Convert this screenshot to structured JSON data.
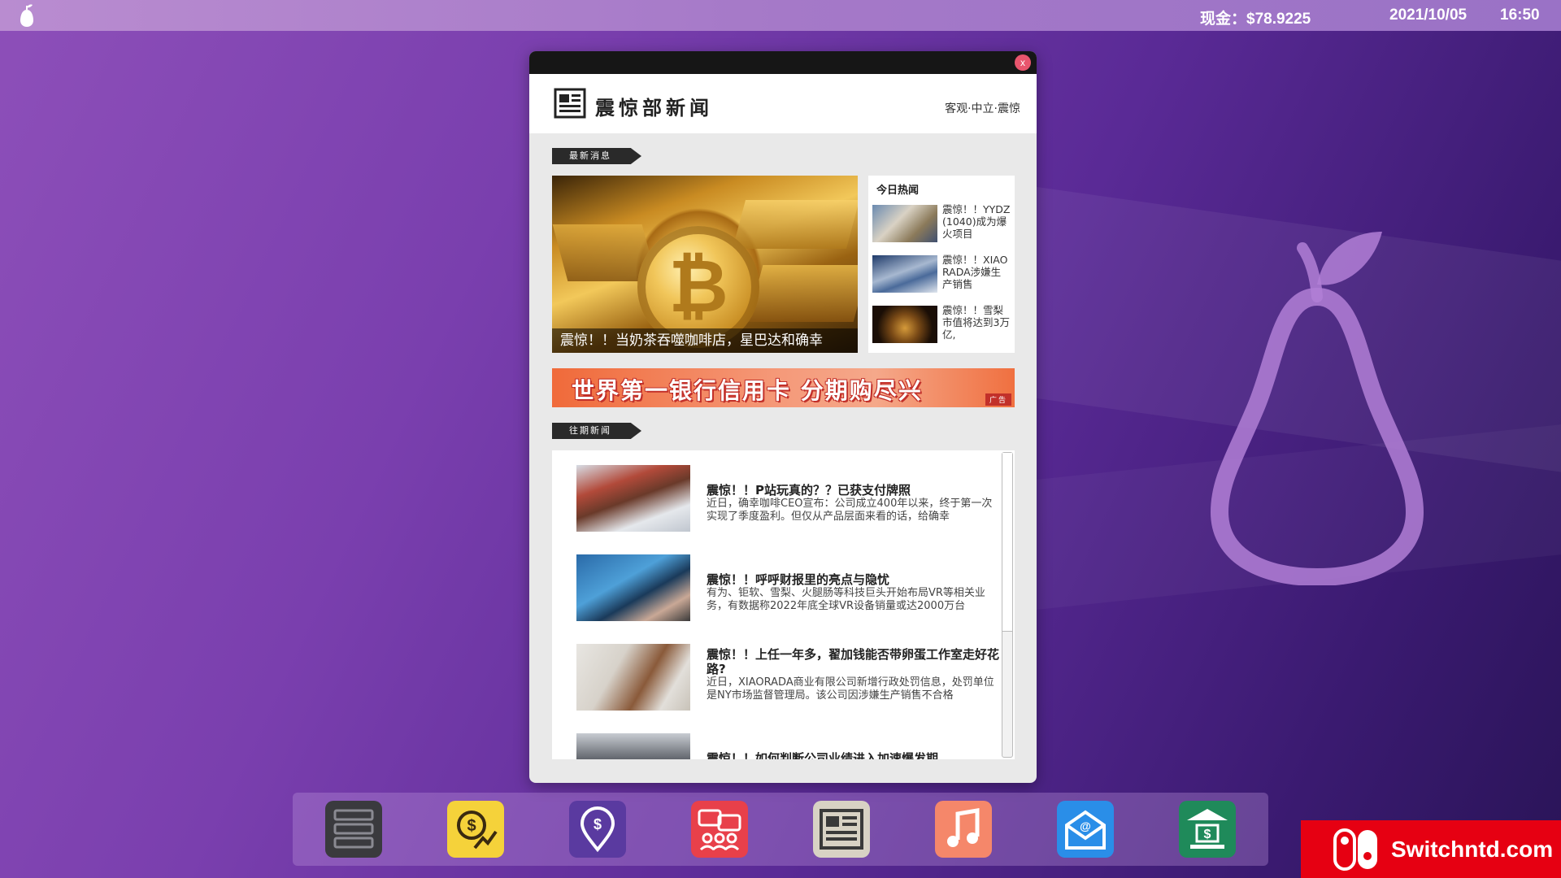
{
  "menubar": {
    "cash": "现金：$78.9225",
    "date": "2021/10/05",
    "time": "16:50"
  },
  "news_window": {
    "close_label": "x",
    "brand": "震惊部新闻",
    "tagline": "客观·中立·震惊",
    "latest_label": "最新消息",
    "hero_caption": "震惊！！当奶茶吞噬咖啡店，星巴达和确幸",
    "hot": {
      "title": "今日热闻",
      "items": [
        {
          "text": "震惊！！YYDZ(1040)成为爆火项目"
        },
        {
          "text": "震惊！！XIAORADA涉嫌生产销售"
        },
        {
          "text": "震惊！！雪梨市值将达到3万亿,"
        }
      ]
    },
    "ad": {
      "text": "世界第一银行信用卡  分期购尽兴",
      "tag": "广告"
    },
    "past_label": "往期新闻",
    "past_articles": [
      {
        "title": "震惊！！P站玩真的？？已获支付牌照",
        "body": "近日，确幸咖啡CEO宣布：公司成立400年以来，终于第一次实现了季度盈利。但仅从产品层面来看的话，给确幸"
      },
      {
        "title": "震惊！！呼呼财报里的亮点与隐忧",
        "body": "有为、钜软、雪梨、火腿肠等科技巨头开始布局VR等相关业务，有数据称2022年底全球VR设备销量或达2000万台"
      },
      {
        "title": "震惊！！上任一年多，翟加钱能否带卵蛋工作室走好花路?",
        "body": "近日，XIAORADA商业有限公司新增行政处罚信息，处罚单位是NY市场监督管理局。该公司因涉嫌生产销售不合格"
      },
      {
        "title": "震惊！！如何判断公司业绩进入加速爆发期",
        "body": ""
      }
    ]
  },
  "dock": {
    "icons": [
      "server-icon",
      "stock-chart-icon",
      "location-dollar-icon",
      "chat-group-icon",
      "newspaper-icon",
      "music-icon",
      "mail-icon",
      "bank-icon"
    ],
    "colors": [
      "#3a3a3e",
      "#f5d23a",
      "#5a3aa0",
      "#e8404a",
      "#d8d2c4",
      "#f5876a",
      "#2a8ee8",
      "#1f8a5a"
    ]
  },
  "watermark": {
    "text": "Switchntd.com"
  }
}
